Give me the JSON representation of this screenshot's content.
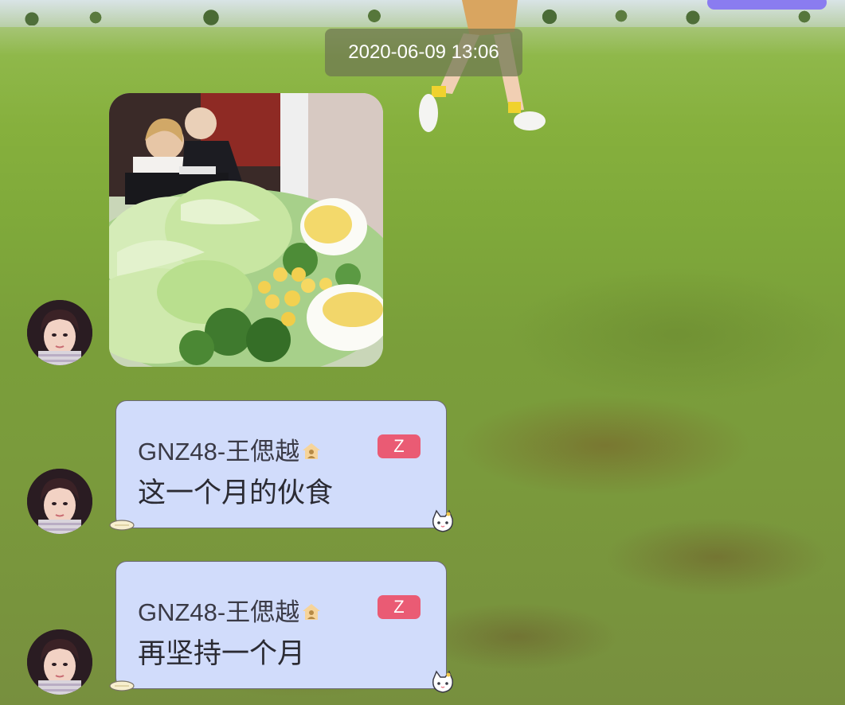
{
  "chat": {
    "timestamp": "2020-06-09 13:06",
    "messages": [
      {
        "type": "image",
        "image_description_icon": "salad-photo",
        "avatar_icon": "member-avatar"
      },
      {
        "type": "text",
        "sender": "GNZ48-王偲越",
        "badge": "Z",
        "text": "这一个月的伙食",
        "avatar_icon": "member-avatar"
      },
      {
        "type": "text",
        "sender": "GNZ48-王偲越",
        "badge": "Z",
        "text": "再坚持一个月",
        "avatar_icon": "member-avatar"
      }
    ]
  },
  "colors": {
    "bubble_bg": "#d1dcfb",
    "badge_bg": "#ea5b74",
    "timestamp_bg": "#6e7650",
    "grass": "#86b03d"
  }
}
